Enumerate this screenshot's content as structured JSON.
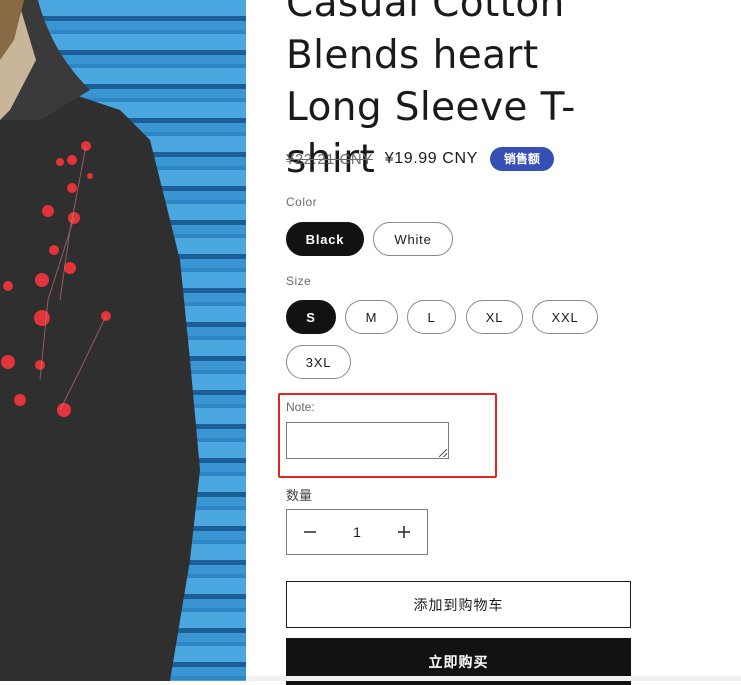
{
  "product": {
    "title": "Casual Cotton Blends heart Long Sleeve T-shirt",
    "price_regular": "¥22.21 CNY",
    "price_sale": "¥19.99 CNY",
    "sale_badge": "销售额",
    "image_icon": "product-photo"
  },
  "color_option": {
    "label": "Color",
    "values": [
      "Black",
      "White"
    ],
    "selected": "Black"
  },
  "size_option": {
    "label": "Size",
    "values": [
      "S",
      "M",
      "L",
      "XL",
      "XXL",
      "3XL"
    ],
    "selected": "S"
  },
  "note": {
    "label": "Note:",
    "value": "",
    "highlight_color": "#e3231e"
  },
  "quantity": {
    "label": "数量",
    "value": "1",
    "minus_icon": "minus-icon",
    "plus_icon": "plus-icon"
  },
  "actions": {
    "add_to_cart": "添加到购物车",
    "buy_now": "立即购买"
  },
  "colors": {
    "accent_badge": "#3650b5",
    "button_dark": "#121212"
  }
}
